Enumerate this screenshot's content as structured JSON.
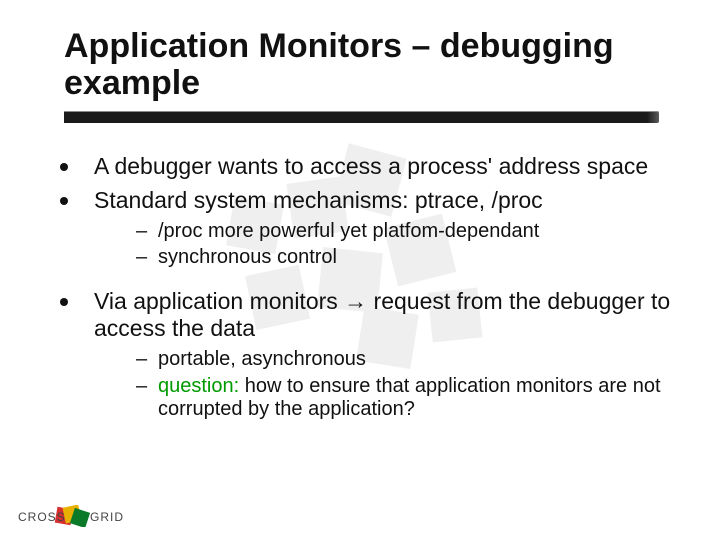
{
  "title": "Application Monitors – debugging example",
  "bullets": {
    "b1": "A debugger wants to access a process' address space",
    "b2": "Standard system mechanisms: ptrace, /proc",
    "b2_sub1": "/proc more powerful yet platfom-dependant",
    "b2_sub2": "synchronous control",
    "b3_pre": "Via application monitors ",
    "b3_arrow": "→",
    "b3_post": " request from the debugger to access the data",
    "b3_sub1": "portable, asynchronous",
    "b3_sub2_q": "question:",
    "b3_sub2_rest": " how to ensure that application monitors are not corrupted by the application?"
  },
  "logo_text_left": "CROSS",
  "logo_text_right": "GRID"
}
